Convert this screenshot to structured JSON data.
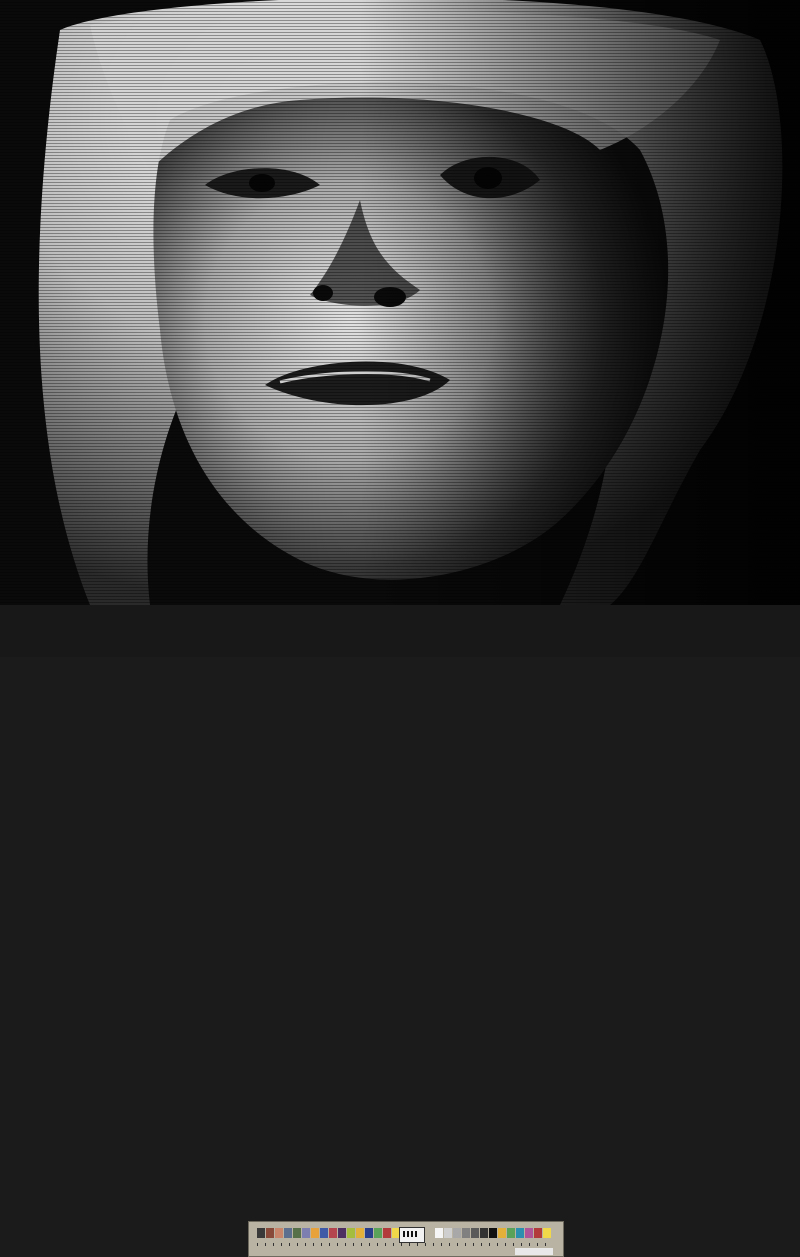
{
  "image": {
    "description_name": "tv-screen-portrait-photo",
    "colors": {
      "background": "#0a0a0a",
      "hair": "#e6e6e6",
      "skin_light": "#d9d9d9",
      "skin_shadow": "#2a2a2a",
      "strip": "#181818",
      "target_base": "#b9b3a3"
    }
  },
  "color_target": {
    "swatches_left": [
      "#3a3a3a",
      "#8a4a3a",
      "#c9866a",
      "#5c6f8e",
      "#56704a",
      "#7d7fb0",
      "#e7a23b",
      "#3f5aa7",
      "#b4454f",
      "#4e2f61",
      "#a4bd3f",
      "#e3b13a",
      "#2a3f8c",
      "#5aa25a",
      "#b33a3a",
      "#f0d84a",
      "#b0549a",
      "#2d8fb0"
    ],
    "swatches_right": [
      "#f5f5f5",
      "#cfcfcf",
      "#a8a8a8",
      "#808080",
      "#5a5a5a",
      "#333333",
      "#111111",
      "#e3b13a",
      "#5aa25a",
      "#2d8fb0",
      "#b0549a",
      "#b33a3a",
      "#f0d84a",
      "#2a3f8c",
      "#7d7fb0"
    ]
  }
}
